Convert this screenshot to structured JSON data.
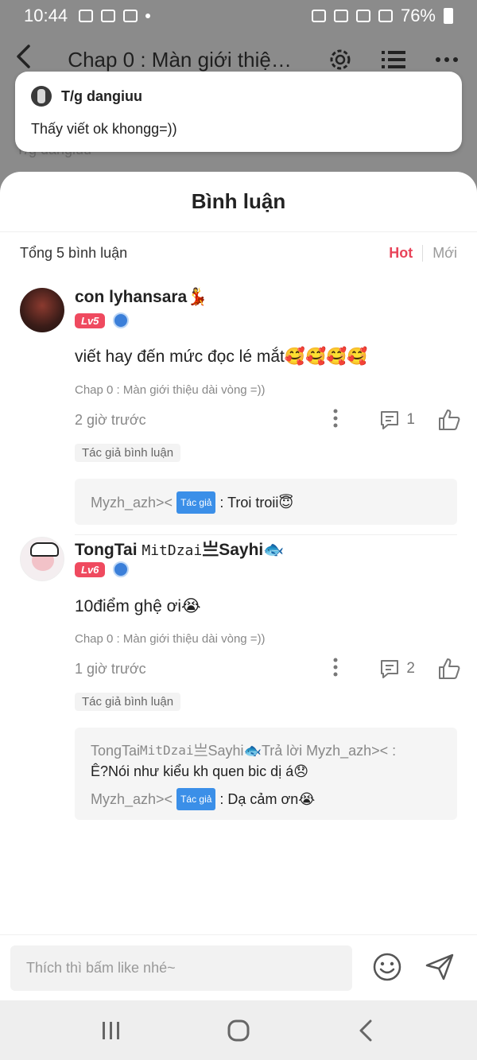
{
  "status_bar": {
    "time": "10:44",
    "battery": "76%"
  },
  "top_bar": {
    "title": "Chap 0 : Màn giới thiệ…"
  },
  "background": {
    "ghost_author": "T/g dangiuu"
  },
  "toast": {
    "author": "T/g dangiuu",
    "message": "Thấy viết ok khongg=))"
  },
  "sheet": {
    "title": "Bình luận",
    "total": "Tổng 5 bình luận",
    "sort": {
      "hot": "Hot",
      "new": "Mới"
    }
  },
  "comments": [
    {
      "name": "con lyhansara💃",
      "level": "Lv5",
      "text": "viết hay đến mức đọc lé mắt🥰🥰🥰🥰",
      "chapter": "Chap 0 : Màn giới thiệu dài vòng =))",
      "time": "2 giờ trước",
      "reply_count": "1",
      "author_tag": "Tác giả bình luận",
      "replies": [
        {
          "user": "Myzh_azh><",
          "badge": "Tác giả",
          "text": ": Troi troii😇"
        }
      ]
    },
    {
      "name_prefix": "TongTai ",
      "name_mono": "MitDzai",
      "name_suffix": "亗Sayhi🐟",
      "level": "Lv6",
      "text": "10điểm ghệ ơi😭",
      "chapter": "Chap 0 : Màn giới thiệu dài vòng =))",
      "time": "1 giờ trước",
      "reply_count": "2",
      "author_tag": "Tác giả bình luận",
      "replies": [
        {
          "user_prefix": "TongTai ",
          "user_mono": "MitDzai",
          "user_suffix": "亗Sayhi🐟",
          "reply_to": " Trả lời Myzh_azh>< :",
          "text": "Ê?Nói như kiểu kh quen bic dị á😞"
        },
        {
          "user": "Myzh_azh><",
          "badge": "Tác giả",
          "text": ": Dạ cảm ơn😭"
        }
      ]
    }
  ],
  "input": {
    "placeholder": "Thích thì bấm like nhé~"
  },
  "icons": {
    "back": "back-arrow-icon",
    "settings": "gear-icon",
    "list": "list-icon",
    "more": "more-dots-icon",
    "reply": "comment-icon",
    "like": "thumbs-up-icon",
    "emoji": "emoji-icon",
    "send": "send-icon"
  }
}
